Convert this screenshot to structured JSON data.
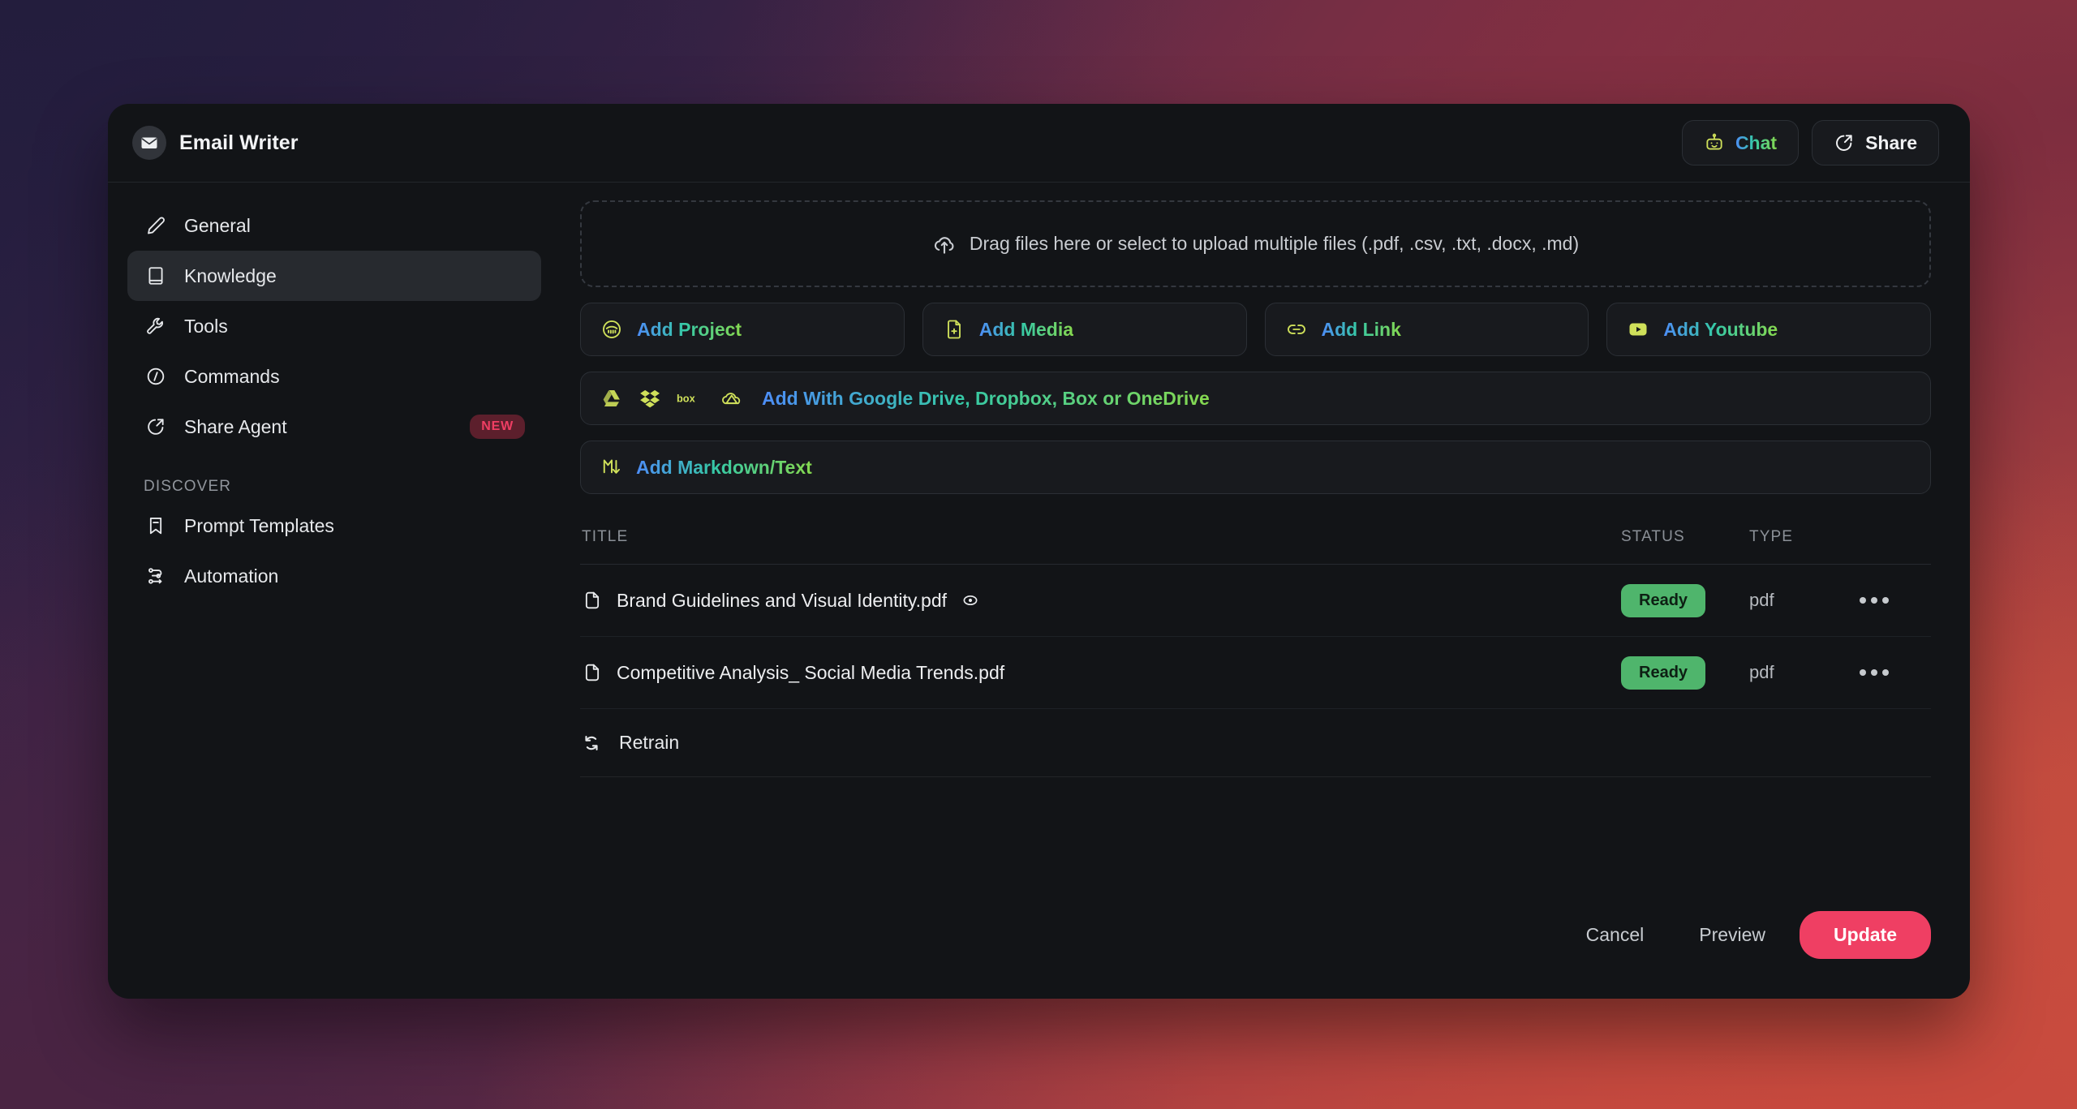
{
  "titlebar": {
    "app_icon": "envelope-icon",
    "title": "Email Writer",
    "chat_button": {
      "label": "Chat",
      "icon": "robot-icon"
    },
    "share_button": {
      "label": "Share",
      "icon": "share-external-icon"
    }
  },
  "sidebar": {
    "items": [
      {
        "label": "General",
        "icon": "pencil-icon",
        "active": false
      },
      {
        "label": "Knowledge",
        "icon": "book-icon",
        "active": true
      },
      {
        "label": "Tools",
        "icon": "wrench-icon",
        "active": false
      },
      {
        "label": "Commands",
        "icon": "slash-circle-icon",
        "active": false
      },
      {
        "label": "Share Agent",
        "icon": "share-circle-icon",
        "active": false,
        "badge": "NEW"
      }
    ],
    "section_label": "DISCOVER",
    "discover_items": [
      {
        "label": "Prompt Templates",
        "icon": "bookmark-minus-icon"
      },
      {
        "label": "Automation",
        "icon": "workflow-icon"
      }
    ]
  },
  "main": {
    "dropzone": {
      "icon": "upload-cloud-icon",
      "text": "Drag files here or select to upload multiple files (.pdf, .csv, .txt, .docx, .md)"
    },
    "add_buttons": [
      {
        "label": "Add Project",
        "icon": "project-avatar-icon"
      },
      {
        "label": "Add Media",
        "icon": "file-plus-icon"
      },
      {
        "label": "Add Link",
        "icon": "link-icon"
      },
      {
        "label": "Add Youtube",
        "icon": "youtube-icon"
      }
    ],
    "cloud_row": {
      "label": "Add With Google Drive, Dropbox, Box or OneDrive",
      "icons": [
        "google-drive-icon",
        "dropbox-icon",
        "box-icon",
        "onedrive-icon"
      ]
    },
    "markdown_row": {
      "label": "Add Markdown/Text",
      "icon": "markdown-icon"
    },
    "table": {
      "columns": [
        "TITLE",
        "STATUS",
        "TYPE"
      ],
      "rows": [
        {
          "icon": "document-icon",
          "title": "Brand Guidelines and Visual Identity.pdf",
          "has_preview_eye": true,
          "status": "Ready",
          "type": "pdf",
          "menu": "more-options-icon"
        },
        {
          "icon": "document-icon",
          "title": "Competitive Analysis_ Social Media Trends.pdf",
          "has_preview_eye": false,
          "status": "Ready",
          "type": "pdf",
          "menu": "more-options-icon"
        }
      ]
    },
    "retrain": {
      "label": "Retrain",
      "icon": "refresh-icon"
    }
  },
  "footer": {
    "cancel_label": "Cancel",
    "preview_label": "Preview",
    "update_label": "Update"
  },
  "colors": {
    "accent_pink": "#ef3f63",
    "status_green": "#4fb56c",
    "badge_new_text": "#ef3e63",
    "gradient_text_start": "#4d8df6",
    "gradient_text_end": "#86d94f",
    "icon_yellow_green": "#cfe05a",
    "window_bg": "#121417"
  }
}
